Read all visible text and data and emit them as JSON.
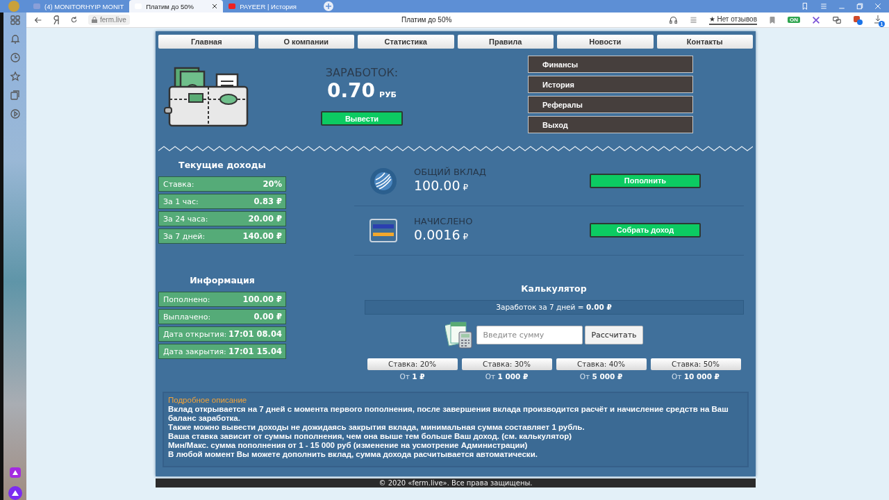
{
  "browser": {
    "tabs": [
      {
        "title": "(4) MONITORHYIP MONIT",
        "selected": false
      },
      {
        "title": "Платим до 50%",
        "selected": true
      },
      {
        "title": "PAYEER | История",
        "selected": false
      }
    ],
    "address": "ferm.live",
    "page_title": "Платим до 50%",
    "reviews": "★ Нет отзывов",
    "extension_badge": "ON",
    "downloads_count": "1"
  },
  "nav": [
    "Главная",
    "О компании",
    "Статистика",
    "Правила",
    "Новости",
    "Контакты"
  ],
  "earnings": {
    "label": "ЗАРАБОТОК:",
    "amount": "0.70",
    "currency": "РУБ",
    "button": "Вывести"
  },
  "account_menu": [
    "Финансы",
    "История",
    "Рефералы",
    "Выход"
  ],
  "current_income": {
    "title": "Текущие доходы",
    "rows": [
      {
        "label": "Ставка:",
        "value": "20%"
      },
      {
        "label": "За 1 час:",
        "value": "0.83 ₽"
      },
      {
        "label": "За 24 часа:",
        "value": "20.00 ₽"
      },
      {
        "label": "За 7 дней:",
        "value": "140.00 ₽"
      }
    ]
  },
  "info": {
    "title": "Информация",
    "rows": [
      {
        "label": "Пополнено:",
        "value": "100.00 ₽"
      },
      {
        "label": "Выплачено:",
        "value": "0.00 ₽"
      },
      {
        "label": "Дата открытия:",
        "value": "17:01 08.04"
      },
      {
        "label": "Дата закрытия:",
        "value": "17:01 15.04"
      }
    ]
  },
  "balances": [
    {
      "kind": "globe",
      "label": "ОБЩИЙ ВКЛАД",
      "amount": "100.00",
      "currency": "₽",
      "button": "Пополнить"
    },
    {
      "kind": "card",
      "label": "НАЧИСЛЕНО",
      "amount": "0.0016",
      "currency": "₽",
      "button": "Собрать доход"
    }
  ],
  "calculator": {
    "title": "Калькулятор",
    "result": "Заработок за 7 дней = **0.00 ₽**",
    "placeholder": "Введите сумму",
    "button": "Рассчитать",
    "tiers": [
      {
        "rate": "Ставка: 20%",
        "min": "От **1 ₽**"
      },
      {
        "rate": "Ставка: 30%",
        "min": "От **1 000 ₽**"
      },
      {
        "rate": "Ставка: 40%",
        "min": "От **5 000 ₽**"
      },
      {
        "rate": "Ставка: 50%",
        "min": "От **10 000 ₽**"
      }
    ]
  },
  "description": {
    "title": "Подробное описание",
    "lines": [
      "Вклад открывается на 7 дней с момента первого пополнения, после завершения вклада производится расчёт и начисление средств на Ваш баланс заработка.",
      "Также можно вывести доходы не дожидаясь закрытия вклада, минимальная сумма составляет 1 рубль.",
      "Ваша ставка зависит от суммы пополнения, чем она выше тем больше Ваш доход. (см. калькулятор)",
      "Мин/Макс. сумма пополнения от 1 - 15 000 руб (изменение на усмотрение Администрации)",
      "В любой момент Вы можете дополнить вклад, сумма дохода расчитывается автоматически."
    ]
  },
  "footer": "© 2020 «ferm.live». Все права защищены."
}
